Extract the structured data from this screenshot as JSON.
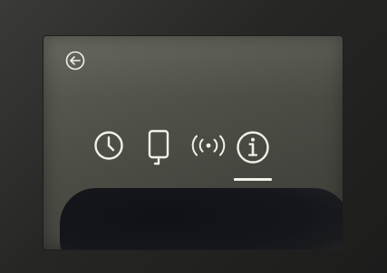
{
  "screen": {
    "nav": {
      "back_icon": "back-arrow-circle-icon",
      "items": [
        {
          "icon": "clock-icon",
          "selected": false
        },
        {
          "icon": "device-icon",
          "selected": false
        },
        {
          "icon": "wireless-signal-icon",
          "selected": false
        },
        {
          "icon": "info-icon",
          "selected": true
        }
      ]
    },
    "colors": {
      "icon_stroke": "#f1f1ea",
      "screen_background": "#52534a",
      "bezel": "#262624"
    }
  }
}
